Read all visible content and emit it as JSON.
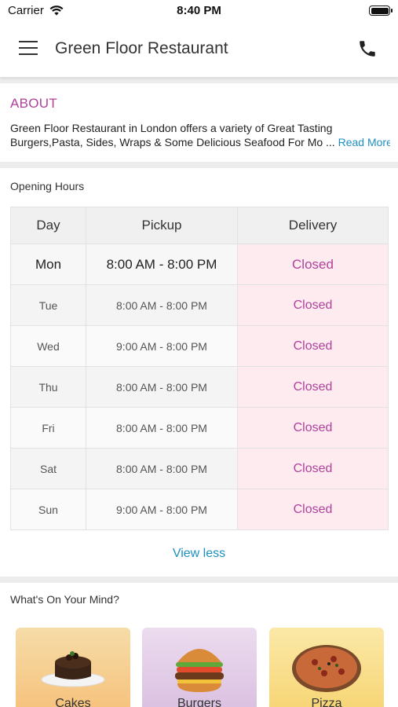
{
  "status": {
    "carrier": "Carrier",
    "time": "8:40 PM"
  },
  "header": {
    "title": "Green Floor Restaurant",
    "menu_icon": "hamburger-icon",
    "call_icon": "phone-icon"
  },
  "about": {
    "title": "ABOUT",
    "line1": "Green Floor Restaurant in London offers a variety of Great Tasting",
    "line2": "Burgers,Pasta, Sides, Wraps & Some Delicious Seafood For Mo ...",
    "read_more": "Read More"
  },
  "hours": {
    "title": "Opening Hours",
    "columns": [
      "Day",
      "Pickup",
      "Delivery"
    ],
    "rows": [
      {
        "day": "Mon",
        "pickup": "8:00 AM - 8:00 PM",
        "delivery": "Closed"
      },
      {
        "day": "Tue",
        "pickup": "8:00 AM - 8:00 PM",
        "delivery": "Closed"
      },
      {
        "day": "Wed",
        "pickup": "9:00 AM - 8:00 PM",
        "delivery": "Closed"
      },
      {
        "day": "Thu",
        "pickup": "8:00 AM - 8:00 PM",
        "delivery": "Closed"
      },
      {
        "day": "Fri",
        "pickup": "8:00 AM - 8:00 PM",
        "delivery": "Closed"
      },
      {
        "day": "Sat",
        "pickup": "8:00 AM - 8:00 PM",
        "delivery": "Closed"
      },
      {
        "day": "Sun",
        "pickup": "9:00 AM - 8:00 PM",
        "delivery": "Closed"
      }
    ],
    "view_less": "View less"
  },
  "mind": {
    "title": "What's On Your Mind?",
    "categories": [
      {
        "label": "Cakes",
        "icon": "cake-icon",
        "bg": "#f8c98a"
      },
      {
        "label": "Burgers",
        "icon": "burger-icon",
        "bg": "#e2cbe6"
      },
      {
        "label": "Pizza",
        "icon": "pizza-icon",
        "bg": "#f8df85"
      }
    ]
  },
  "colors": {
    "accent": "#b0429b",
    "link": "#1e8fc0",
    "closed_bg": "#fdebf0"
  }
}
